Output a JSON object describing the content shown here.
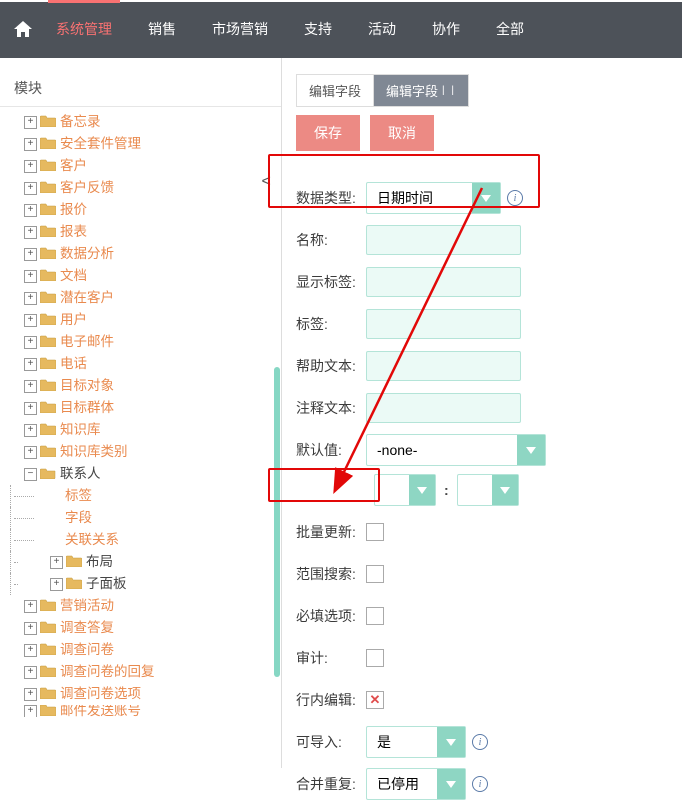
{
  "nav": {
    "items": [
      "系统管理",
      "销售",
      "市场营销",
      "支持",
      "活动",
      "协作",
      "全部"
    ],
    "active_index": 0
  },
  "sidebar": {
    "title": "模块",
    "tree": [
      {
        "label": "备忘录",
        "link": "orange",
        "exp": "+"
      },
      {
        "label": "安全套件管理",
        "link": "orange",
        "exp": "+"
      },
      {
        "label": "客户",
        "link": "orange",
        "exp": "+"
      },
      {
        "label": "客户反馈",
        "link": "orange",
        "exp": "+"
      },
      {
        "label": "报价",
        "link": "orange",
        "exp": "+"
      },
      {
        "label": "报表",
        "link": "orange",
        "exp": "+"
      },
      {
        "label": "数据分析",
        "link": "orange",
        "exp": "+"
      },
      {
        "label": "文档",
        "link": "orange",
        "exp": "+"
      },
      {
        "label": "潜在客户",
        "link": "orange",
        "exp": "+"
      },
      {
        "label": "用户",
        "link": "orange",
        "exp": "+"
      },
      {
        "label": "电子邮件",
        "link": "orange",
        "exp": "+"
      },
      {
        "label": "电话",
        "link": "orange",
        "exp": "+"
      },
      {
        "label": "目标对象",
        "link": "orange",
        "exp": "+"
      },
      {
        "label": "目标群体",
        "link": "orange",
        "exp": "+"
      },
      {
        "label": "知识库",
        "link": "orange",
        "exp": "+"
      },
      {
        "label": "知识库类别",
        "link": "orange",
        "exp": "+"
      },
      {
        "label": "联系人",
        "link": "dark",
        "exp": "-",
        "open": true
      },
      {
        "label": "标签",
        "link": "orange",
        "child": true
      },
      {
        "label": "字段",
        "link": "orange",
        "child": true
      },
      {
        "label": "关联关系",
        "link": "orange",
        "child": true
      },
      {
        "label": "布局",
        "link": "dark",
        "child": true,
        "folder": true,
        "exp": "+"
      },
      {
        "label": "子面板",
        "link": "dark",
        "child": true,
        "folder": true,
        "exp": "+"
      },
      {
        "label": "营销活动",
        "link": "orange",
        "exp": "+"
      },
      {
        "label": "调查答复",
        "link": "orange",
        "exp": "+"
      },
      {
        "label": "调查问卷",
        "link": "orange",
        "exp": "+"
      },
      {
        "label": "调查问卷的回复",
        "link": "orange",
        "exp": "+"
      },
      {
        "label": "调查问卷选项",
        "link": "orange",
        "exp": "+"
      },
      {
        "label": "邮件发送账号",
        "link": "orange",
        "exp": "+",
        "cut": true
      }
    ]
  },
  "tabs": {
    "list": [
      "编辑字段",
      "编辑字段"
    ],
    "active_index": 1
  },
  "buttons": {
    "save": "保存",
    "cancel": "取消"
  },
  "form": {
    "data_type": {
      "label": "数据类型:",
      "value": "日期时间"
    },
    "name": {
      "label": "名称:",
      "value": ""
    },
    "display_label": {
      "label": "显示标签:",
      "value": ""
    },
    "tag": {
      "label": "标签:",
      "value": ""
    },
    "help_text": {
      "label": "帮助文本:",
      "value": ""
    },
    "comment_text": {
      "label": "注释文本:",
      "value": ""
    },
    "default_value": {
      "label": "默认值:",
      "value": "-none-"
    },
    "time_sep": ":",
    "mass_update": {
      "label": "批量更新:",
      "checked": false
    },
    "range_search": {
      "label": "范围搜索:",
      "checked": false
    },
    "required": {
      "label": "必填选项:",
      "checked": false
    },
    "audit": {
      "label": "审计:",
      "checked": false
    },
    "inline_edit": {
      "label": "行内编辑:",
      "checked": "x"
    },
    "importable": {
      "label": "可导入:",
      "value": "是"
    },
    "merge_dup": {
      "label": "合并重复:",
      "value": "已停用"
    }
  }
}
